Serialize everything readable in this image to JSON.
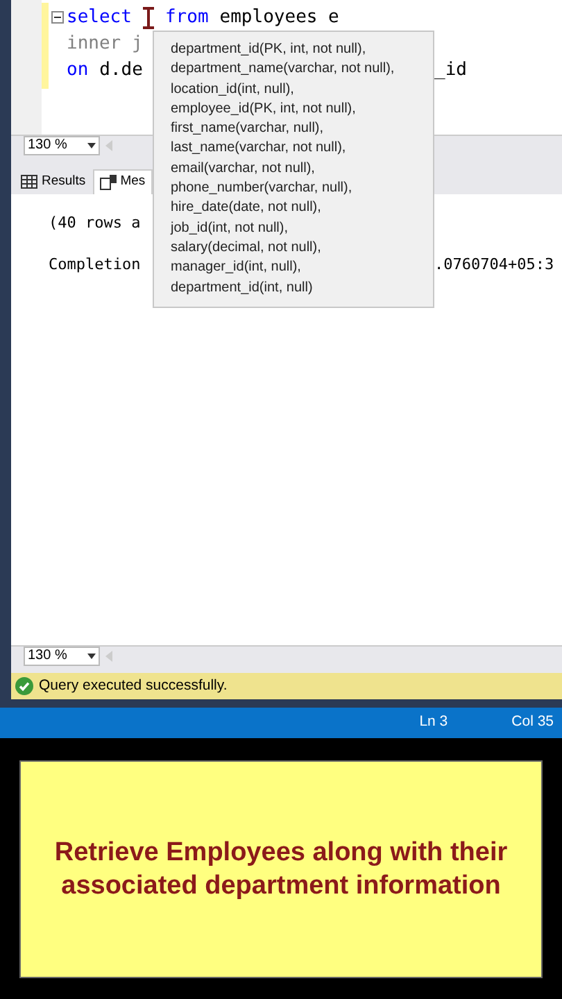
{
  "editor": {
    "lines": [
      {
        "collapse_toggle": true,
        "segments": [
          {
            "text": "select",
            "kind": "keyword",
            "cursor": true
          },
          {
            "text": "from",
            "kind": "keyword"
          },
          {
            "text": "employees e",
            "kind": "plain"
          }
        ]
      },
      {
        "collapse_toggle": false,
        "segments": [
          {
            "text": "inner j",
            "kind": "gray"
          }
        ]
      },
      {
        "collapse_toggle": false,
        "segments": [
          {
            "text": "on",
            "kind": "keyword"
          },
          {
            "text": "d.de",
            "kind": "plain"
          }
        ],
        "tail": "_id"
      }
    ],
    "zoom": "130 %",
    "popup": [
      "department_id(PK, int, not null),",
      "department_name(varchar, not null),",
      "location_id(int, null),",
      "employee_id(PK, int, not null),",
      "first_name(varchar, null),",
      "last_name(varchar, not null),",
      "email(varchar, not null),",
      "phone_number(varchar, null),",
      "hire_date(date, not null),",
      "job_id(int, not null),",
      "salary(decimal, not null),",
      "manager_id(int, null),",
      "department_id(int, null)"
    ]
  },
  "results": {
    "tabs": [
      {
        "label": "Results",
        "kind": "grid",
        "selected": false
      },
      {
        "label": "Mes",
        "kind": "messages",
        "selected": true
      }
    ],
    "messages": [
      {
        "text": "(40 rows a"
      },
      {
        "text": "Completion",
        "tail": ".0760704+05:3"
      }
    ],
    "zoom": "130 %"
  },
  "query_status": "Query executed successfully.",
  "status_bar": {
    "line": "Ln 3",
    "col": "Col 35"
  },
  "caption": "Retrieve Employees along with their associated department information"
}
